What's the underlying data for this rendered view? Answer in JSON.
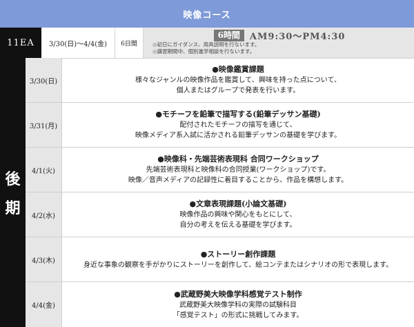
{
  "header": {
    "title": "映像コース"
  },
  "course": {
    "code": "11EA",
    "dates": "3/30(日)～4/4(金)",
    "days": "6日間",
    "hours": "6時間",
    "time_range": "AM9:30～PM4:30",
    "notes": [
      "初日にガイダンス、用具説明を行ないます。",
      "講習期間中、個別進学相談を行ないます。"
    ],
    "note_icon": "circle-bullet-icon"
  },
  "term": {
    "char1": "後",
    "char2": "期"
  },
  "schedule": [
    {
      "date": "3/30(日)",
      "title": "●映像鑑賞課題",
      "lines": [
        "様々なジャンルの映像作品を鑑賞して、興味を持った点について、",
        "個人またはグループで発表を行います。"
      ]
    },
    {
      "date": "3/31(月)",
      "title": "●モチーフを鉛筆で描写する(鉛筆デッサン基礎)",
      "lines": [
        "配付されたモチーフの描写を通じて、",
        "映像メディア系入試に活かされる鉛筆デッサンの基礎を学びます。"
      ]
    },
    {
      "date": "4/1(火)",
      "title": "●映像科・先端芸術表現科 合同ワークショップ",
      "lines": [
        "先端芸術表現科と映像科の合同授業(ワークショップ)です。",
        "映像／音声メディアの記録性に着目することから、作品を構想します。"
      ]
    },
    {
      "date": "4/2(水)",
      "title": "●文章表現課題(小論文基礎)",
      "lines": [
        "映像作品の興味や関心をもとにして、",
        "自分の考えを伝える基礎を学びます。"
      ]
    },
    {
      "date": "4/3(木)",
      "title": "●ストーリー創作課題",
      "lines": [
        "身近な事象の観察を手がかりにストーリーを創作して、絵コンテまたはシナリオの形で表現します。"
      ]
    },
    {
      "date": "4/4(金)",
      "title": "●武蔵野美大映像学科感覚テスト制作",
      "lines": [
        "武蔵野美大映像学科の実際の試験科目",
        "「感覚テスト」の形式に挑戦してみます。"
      ]
    }
  ]
}
